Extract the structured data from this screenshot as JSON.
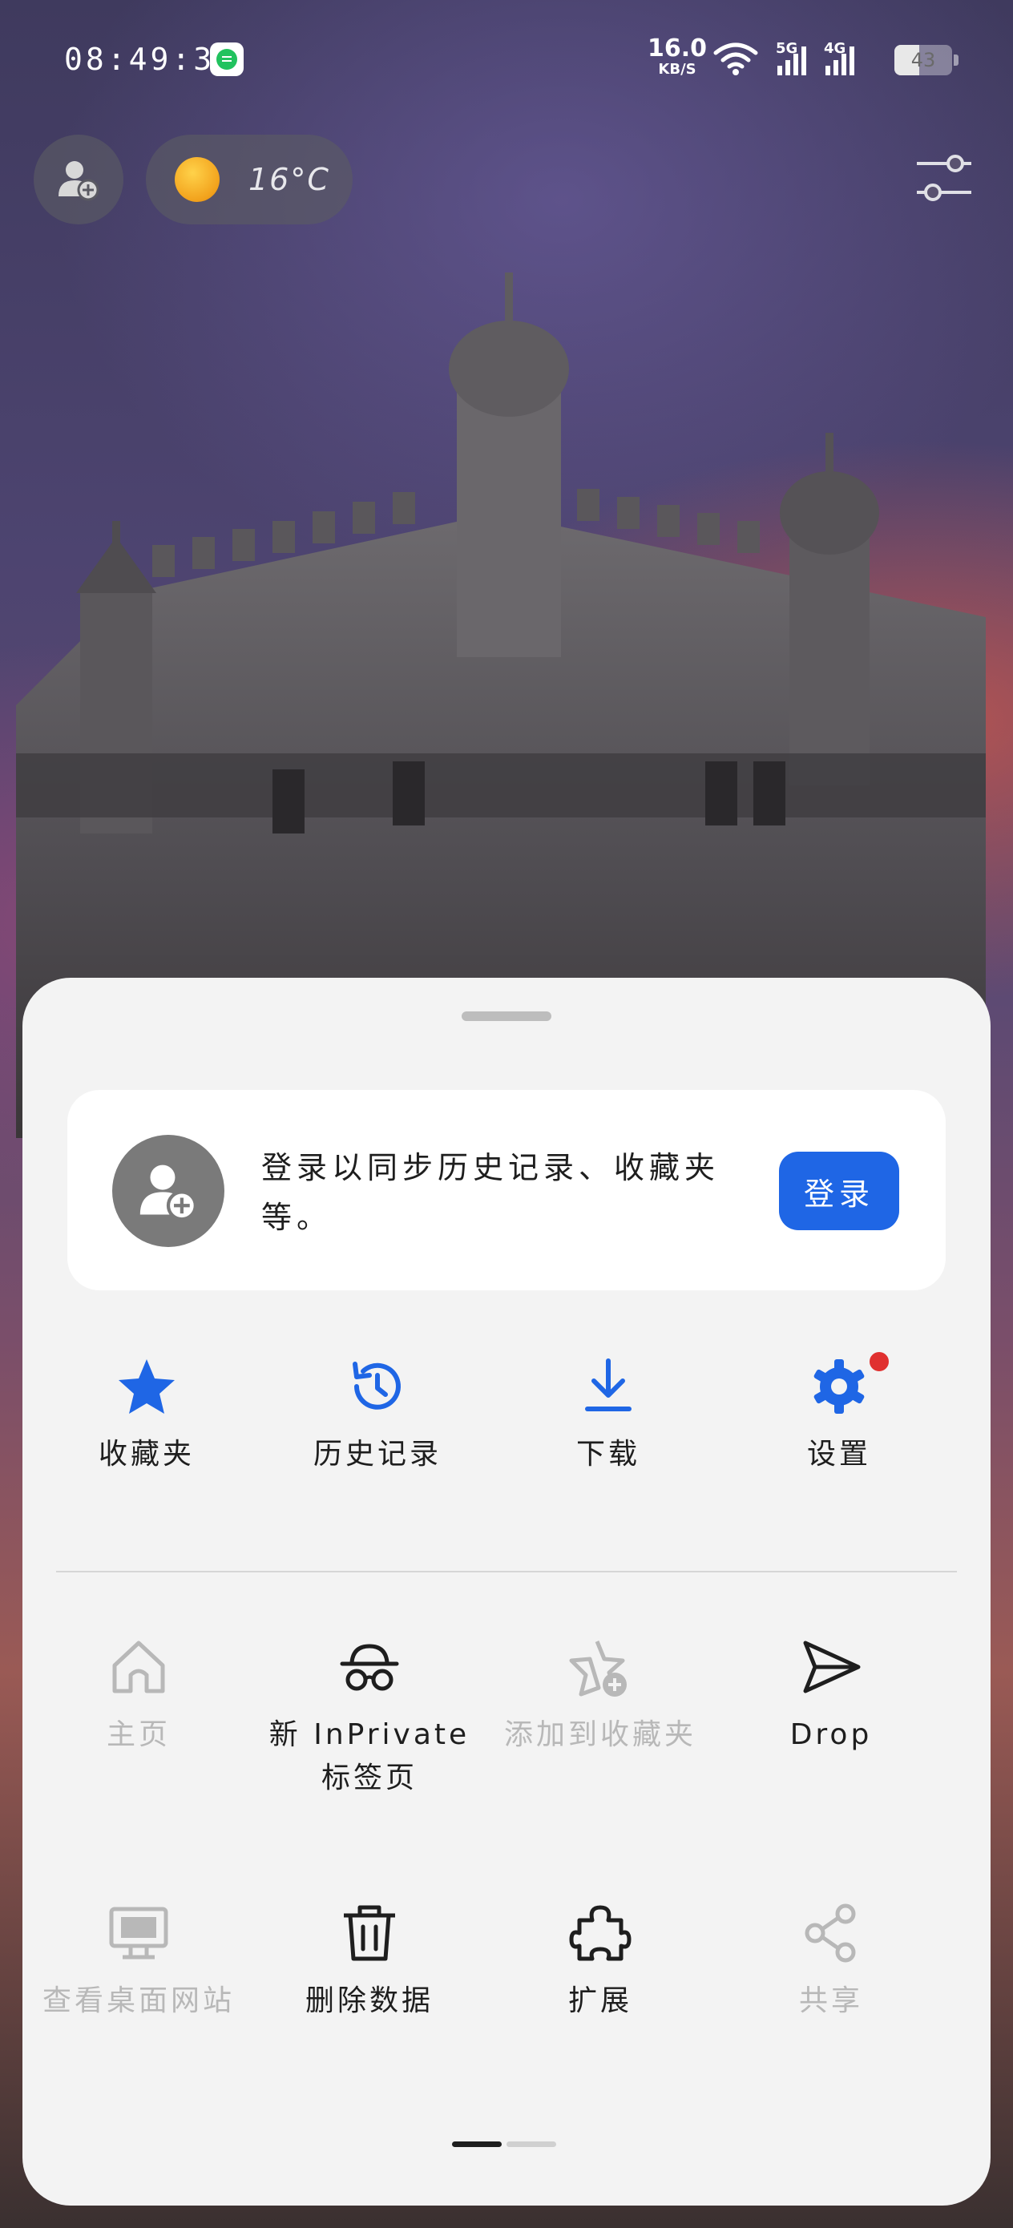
{
  "status_bar": {
    "time": "08:49:39",
    "net_speed_value": "16.0",
    "net_speed_unit": "KB/S",
    "signal_5g": "5G",
    "signal_4g": "4G",
    "battery_level": "43",
    "battery_fraction": 0.43
  },
  "top": {
    "temperature": "16°C"
  },
  "sheet": {
    "signin": {
      "prompt": "登录以同步历史记录、收藏夹等。",
      "button": "登录"
    },
    "quick_actions": [
      {
        "label": "收藏夹",
        "icon": "star-icon"
      },
      {
        "label": "历史记录",
        "icon": "history-icon"
      },
      {
        "label": "下载",
        "icon": "download-icon"
      },
      {
        "label": "设置",
        "icon": "gear-icon"
      }
    ],
    "menu_row1": [
      {
        "label": "主页",
        "icon": "home-icon",
        "enabled": false
      },
      {
        "label_line1": "新 InPrivate",
        "label_line2": "标签页",
        "icon": "inprivate-icon",
        "enabled": true
      },
      {
        "label": "添加到收藏夹",
        "icon": "add-favorite-icon",
        "enabled": false
      },
      {
        "label": "Drop",
        "icon": "send-icon",
        "enabled": true
      }
    ],
    "menu_row2": [
      {
        "label": "查看桌面网站",
        "icon": "desktop-icon",
        "enabled": false
      },
      {
        "label": "删除数据",
        "icon": "trash-icon",
        "enabled": true
      },
      {
        "label": "扩展",
        "icon": "puzzle-icon",
        "enabled": true
      },
      {
        "label": "共享",
        "icon": "share-icon",
        "enabled": false
      }
    ]
  },
  "colors": {
    "accent": "#1f66e5",
    "badge": "#e0302f",
    "disabled": "#b8b8b8",
    "sheet_bg": "#f3f3f3"
  }
}
